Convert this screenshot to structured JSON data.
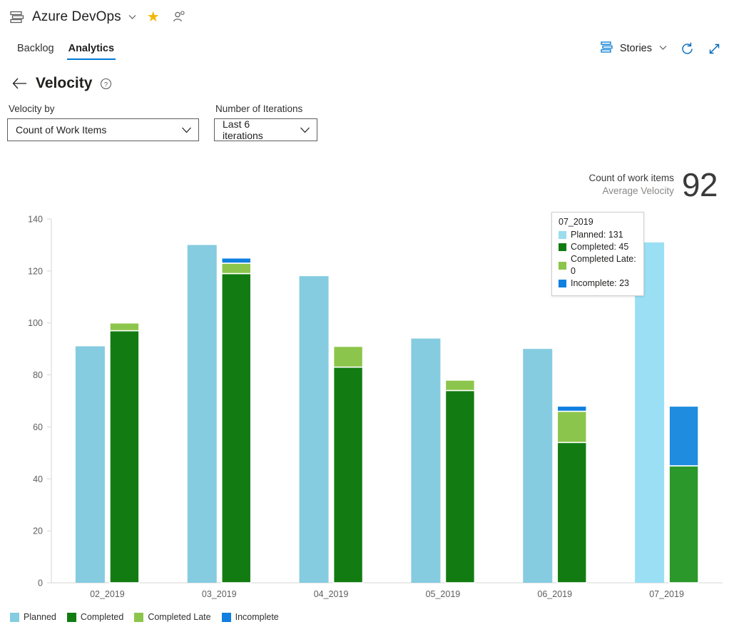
{
  "topbar": {
    "org_icon": "backlog-board-icon",
    "org_name": "Azure DevOps",
    "caret_icon": "chevron-down-icon",
    "favorite_icon": "star-icon",
    "favorite_color": "#f2b705",
    "people_icon": "team-members-icon"
  },
  "tabs": [
    {
      "label": "Backlog",
      "active": false
    },
    {
      "label": "Analytics",
      "active": true
    }
  ],
  "toolbar": {
    "stories_icon": "backlog-levels-icon",
    "stories_label": "Stories",
    "stories_caret": "chevron-down-icon",
    "refresh_icon": "refresh-icon",
    "fullscreen_icon": "expand-diagonal-icon",
    "accent": "#0078d4"
  },
  "header": {
    "back_icon": "arrow-left-icon",
    "title": "Velocity",
    "help_icon": "question-circle-icon"
  },
  "filters": {
    "velocity_by": {
      "label": "Velocity by",
      "value": "Count of Work Items",
      "caret_icon": "chevron-down-icon"
    },
    "iterations": {
      "label": "Number of Iterations",
      "value": "Last 6 iterations",
      "caret_icon": "chevron-down-icon"
    }
  },
  "summary": {
    "metric_label": "Count of work items",
    "sub_label": "Average Velocity",
    "value": "92"
  },
  "tooltip": {
    "title": "07_2019",
    "rows": [
      {
        "label": "Planned: 131",
        "color": "#9BDCEF"
      },
      {
        "label": "Completed: 45",
        "color": "#107C10"
      },
      {
        "label": "Completed Late: 0",
        "color": "#8CC54B"
      },
      {
        "label": "Incomplete: 23",
        "color": "#0F7FE0"
      }
    ]
  },
  "legend": [
    {
      "label": "Planned",
      "color": "#85CCE0"
    },
    {
      "label": "Completed",
      "color": "#127C12"
    },
    {
      "label": "Completed Late",
      "color": "#8CC54B"
    },
    {
      "label": "Incomplete",
      "color": "#0F7FE0"
    }
  ],
  "chart_data": {
    "type": "bar",
    "subtype": "grouped-stacked",
    "title": "",
    "xlabel": "",
    "ylabel": "",
    "ylim": [
      0,
      140
    ],
    "yticks": [
      0,
      20,
      40,
      60,
      80,
      100,
      120,
      140
    ],
    "grid": false,
    "legend_position": "bottom-left",
    "categories": [
      "02_2019",
      "03_2019",
      "04_2019",
      "05_2019",
      "06_2019",
      "07_2019"
    ],
    "series": [
      {
        "name": "Planned",
        "color": "#85CCE0",
        "highlight_color": "#9BDFF5",
        "values": [
          91,
          130,
          118,
          94,
          90,
          131
        ]
      },
      {
        "name": "Completed",
        "color": "#127C12",
        "highlight_color": "#2B982B",
        "values": [
          97,
          119,
          83,
          74,
          54,
          45
        ]
      },
      {
        "name": "Completed Late",
        "color": "#8CC54B",
        "highlight_color": "#8CC54B",
        "values": [
          3,
          4,
          8,
          4,
          12,
          0
        ]
      },
      {
        "name": "Incomplete",
        "color": "#0F7FE0",
        "highlight_color": "#1F8CE0",
        "values": [
          0,
          2,
          0,
          0,
          2,
          23
        ]
      }
    ],
    "highlighted_category": "07_2019",
    "notes": "Planned is a separate bar; Completed, Completed Late and Incomplete stack into a second bar per iteration."
  }
}
